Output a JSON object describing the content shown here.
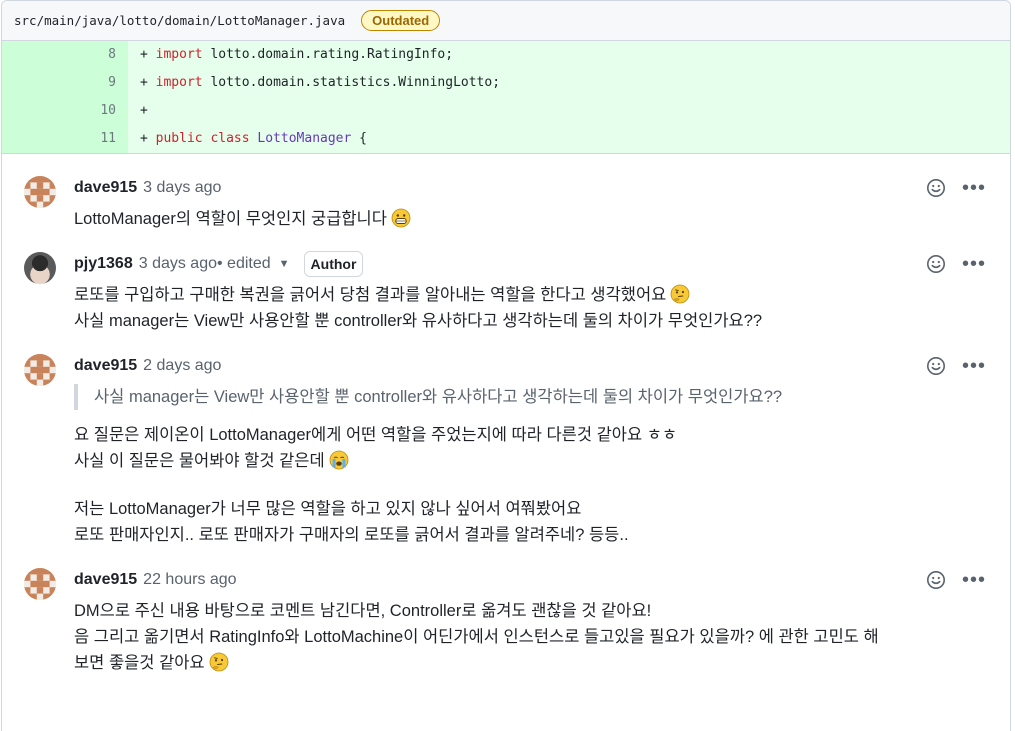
{
  "file": {
    "path": "src/main/java/lotto/domain/LottoManager.java",
    "badge": "Outdated"
  },
  "diff": [
    {
      "line": "8",
      "plus": "+ ",
      "kw": "import",
      "rest": " lotto.domain.rating.RatingInfo;",
      "cls": "",
      "tail": ""
    },
    {
      "line": "9",
      "plus": "+ ",
      "kw": "import",
      "rest": " lotto.domain.statistics.WinningLotto;",
      "cls": "",
      "tail": ""
    },
    {
      "line": "10",
      "plus": "+",
      "kw": "",
      "rest": "",
      "cls": "",
      "tail": ""
    },
    {
      "line": "11",
      "plus": "+ ",
      "kw": "public class",
      "rest": " ",
      "cls": "LottoManager",
      "tail": " {"
    }
  ],
  "comments": [
    {
      "author": "dave915",
      "time": "3 days ago",
      "lines": [
        "LottoManager의 역할이 무엇인지 궁급합니다"
      ],
      "emoji": "grin-emoji"
    },
    {
      "author": "pjy1368",
      "time": "3 days ago",
      "edited": " • edited",
      "badge": "Author",
      "lines": [
        "로또를 구입하고 구매한 복권을 긁어서 당첨 결과를 알아내는 역할을 한다고 생각했어요",
        "사실 manager는 View만 사용안할 뿐 controller와 유사하다고 생각하는데 둘의 차이가 무엇인가요??"
      ],
      "emoji": "thinking-emoji"
    },
    {
      "author": "dave915",
      "time": "2 days ago",
      "quote": "사실 manager는 View만 사용안할 뿐 controller와 유사하다고 생각하는데 둘의 차이가 무엇인가요??",
      "lines": [
        "요 질문은 제이온이 LottoManager에게 어떤 역할을 주었는지에 따라 다른것 같아요 ㅎㅎ",
        "사실 이 질문은 물어봐야 할것 같은데"
      ],
      "lines2": [
        "저는 LottoManager가 너무 많은 역할을 하고 있지 않나 싶어서 여쭤봤어요",
        "로또 판매자인지.. 로또 판매자가 구매자의 로또를 긁어서 결과를 알려주네? 등등.."
      ],
      "emoji": "sob-emoji"
    },
    {
      "author": "dave915",
      "time": "22 hours ago",
      "lines": [
        "DM으로 주신 내용 바탕으로 코멘트 남긴다면, Controller로 옮겨도 괜찮을 것 같아요!",
        "음 그리고 옮기면서 RatingInfo와 LottoMachine이 어딘가에서 인스턴스로 들고있을 필요가 있을까? 에 관한 고민도 해",
        "보면 좋을것 같아요"
      ],
      "emoji": "thinking-emoji"
    }
  ],
  "colors": {
    "diff_bg": "#e6ffec",
    "gutter_bg": "#ccffd8",
    "keyword": "#cf222e",
    "class_name": "#6639ba"
  }
}
